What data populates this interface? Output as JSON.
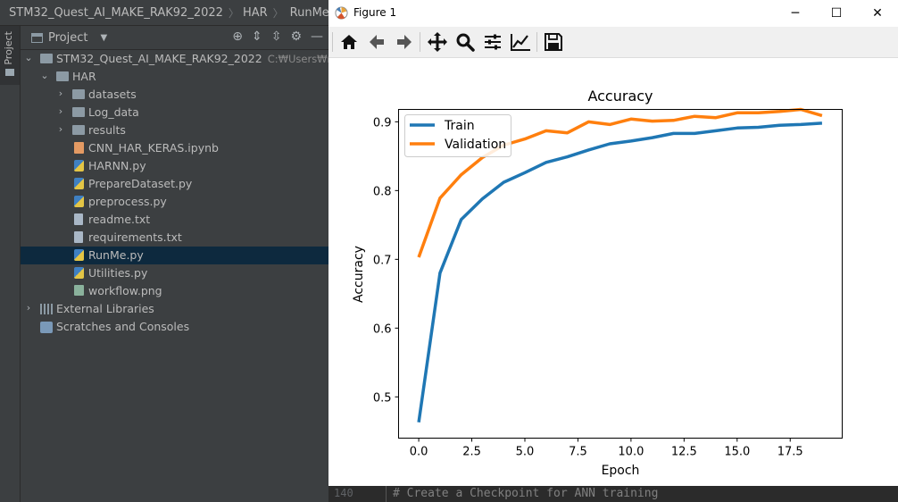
{
  "breadcrumb": {
    "project": "STM32_Quest_AI_MAKE_RAK92_2022",
    "folder": "HAR",
    "file": "RunMe.py"
  },
  "sidebar_tab": {
    "label": "Project"
  },
  "project_panel": {
    "title": "Project"
  },
  "tree": {
    "root": {
      "label": "STM32_Quest_AI_MAKE_RAK92_2022",
      "hint": "C:₩Users₩rhjo₩"
    },
    "har": "HAR",
    "datasets": "datasets",
    "log_data": "Log_data",
    "results": "results",
    "files": [
      "CNN_HAR_KERAS.ipynb",
      "HARNN.py",
      "PrepareDataset.py",
      "preprocess.py",
      "readme.txt",
      "requirements.txt",
      "RunMe.py",
      "Utilities.py",
      "workflow.png"
    ],
    "external_libraries": "External Libraries",
    "scratches": "Scratches and Consoles"
  },
  "editor": {
    "line_number": "140",
    "code": "# Create a Checkpoint for ANN training"
  },
  "figure_window": {
    "title": "Figure 1"
  },
  "toolbar_icons": [
    "home-icon",
    "back-icon",
    "forward-icon",
    "pan-icon",
    "zoom-icon",
    "configure-subplots-icon",
    "edit-axis-icon",
    "save-icon"
  ],
  "colors": {
    "train": "#1f77b4",
    "validation": "#ff7f0e",
    "selected_row": "#0d293e"
  },
  "chart_data": {
    "type": "line",
    "title": "Accuracy",
    "xlabel": "Epoch",
    "ylabel": "Accuracy",
    "xlim": [
      -0.95,
      19.95
    ],
    "ylim": [
      0.44,
      0.918
    ],
    "xticks": [
      "0.0",
      "2.5",
      "5.0",
      "7.5",
      "10.0",
      "12.5",
      "15.0",
      "17.5"
    ],
    "xtick_values": [
      0,
      2.5,
      5,
      7.5,
      10,
      12.5,
      15,
      17.5
    ],
    "yticks": [
      "0.5",
      "0.6",
      "0.7",
      "0.8",
      "0.9"
    ],
    "ytick_values": [
      0.5,
      0.6,
      0.7,
      0.8,
      0.9
    ],
    "legend_position": "top-left",
    "x": [
      0,
      1,
      2,
      3,
      4,
      5,
      6,
      7,
      8,
      9,
      10,
      11,
      12,
      13,
      14,
      15,
      16,
      17,
      18,
      19
    ],
    "series": [
      {
        "name": "Train",
        "color": "#1f77b4",
        "values": [
          0.463,
          0.68,
          0.758,
          0.788,
          0.812,
          0.826,
          0.841,
          0.849,
          0.859,
          0.868,
          0.872,
          0.877,
          0.883,
          0.883,
          0.887,
          0.891,
          0.892,
          0.895,
          0.896,
          0.898
        ]
      },
      {
        "name": "Validation",
        "color": "#ff7f0e",
        "values": [
          0.703,
          0.789,
          0.823,
          0.848,
          0.866,
          0.875,
          0.887,
          0.884,
          0.9,
          0.896,
          0.904,
          0.901,
          0.902,
          0.908,
          0.906,
          0.913,
          0.913,
          0.915,
          0.918,
          0.909
        ]
      }
    ]
  }
}
